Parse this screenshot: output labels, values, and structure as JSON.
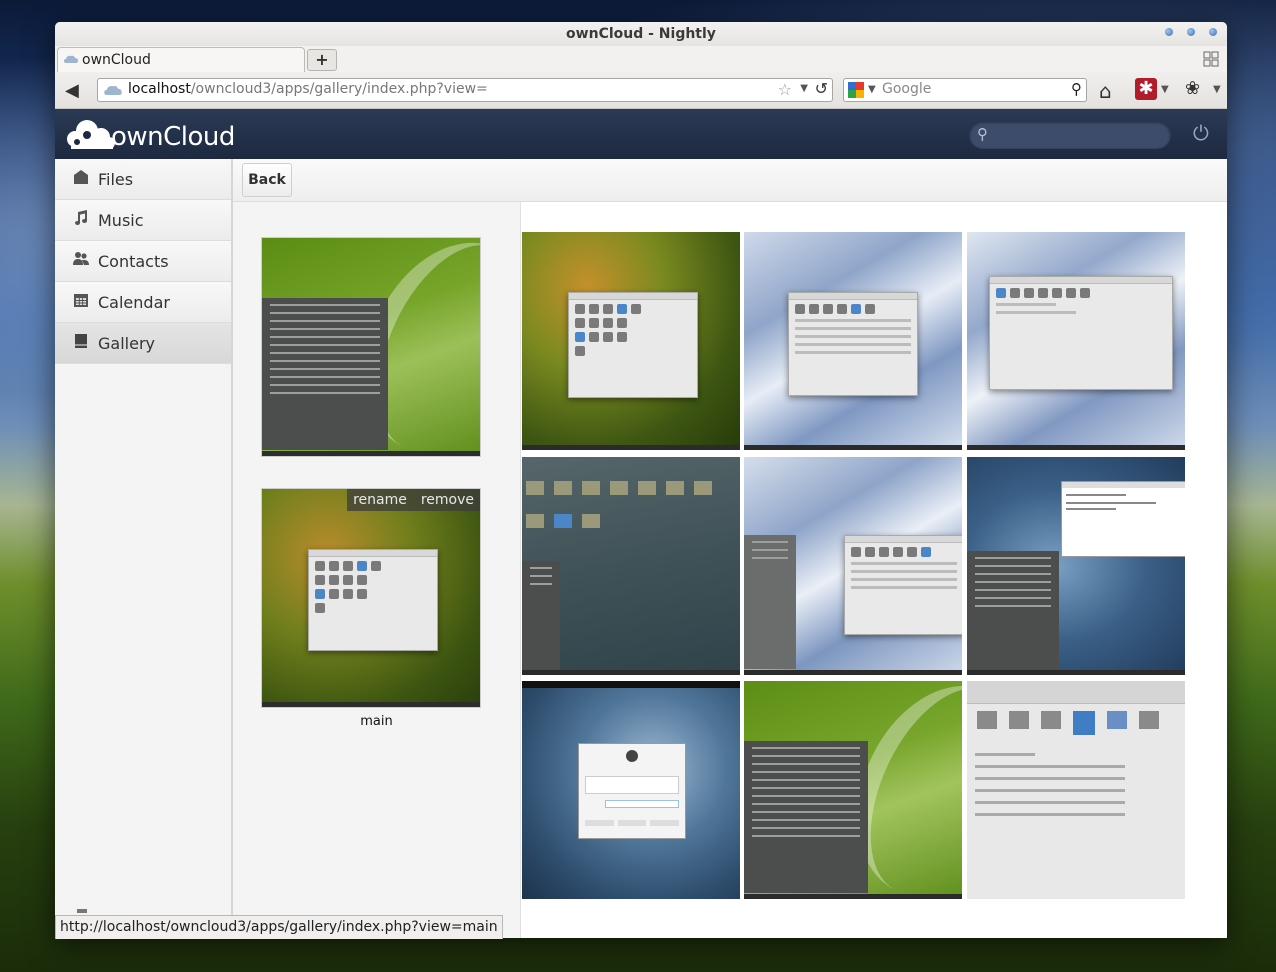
{
  "browser": {
    "window_title": "ownCloud - Nightly",
    "tab_title": "ownCloud",
    "url_host": "localhost",
    "url_path": "/owncloud3/apps/gallery/index.php?view=",
    "search_placeholder": "Google",
    "status_url": "http://localhost/owncloud3/apps/gallery/index.php?view=main"
  },
  "header": {
    "logo_text": "ownCloud"
  },
  "sidebar": {
    "items": [
      {
        "label": "Files",
        "icon": "folder-icon"
      },
      {
        "label": "Music",
        "icon": "music-note-icon"
      },
      {
        "label": "Contacts",
        "icon": "contacts-icon"
      },
      {
        "label": "Calendar",
        "icon": "calendar-icon"
      },
      {
        "label": "Gallery",
        "icon": "gallery-icon",
        "active": true
      }
    ]
  },
  "toolbar": {
    "back_label": "Back"
  },
  "albums": [
    {
      "label": "",
      "theme": "green-openSUSE-menu"
    },
    {
      "label": "main",
      "theme": "moss-cinnamon-settings",
      "actions": {
        "rename": "rename",
        "remove": "remove"
      }
    }
  ],
  "photos": [
    {
      "theme": "moss-cinnamon-settings"
    },
    {
      "theme": "blue-silk-effects-dialog"
    },
    {
      "theme": "blue-silk-themes-dialog"
    },
    {
      "theme": "dark-desktop-icons"
    },
    {
      "theme": "blue-silk-applets-dialog"
    },
    {
      "theme": "dark-terminal"
    },
    {
      "theme": "login-screen"
    },
    {
      "theme": "green-openSUSE-menu"
    },
    {
      "theme": "cinnamon-effects-zoom"
    }
  ],
  "colors": {
    "header_bg": "#1d2940",
    "sidebar_bg": "#f4f4f4",
    "addon_red": "#b11c2b"
  }
}
